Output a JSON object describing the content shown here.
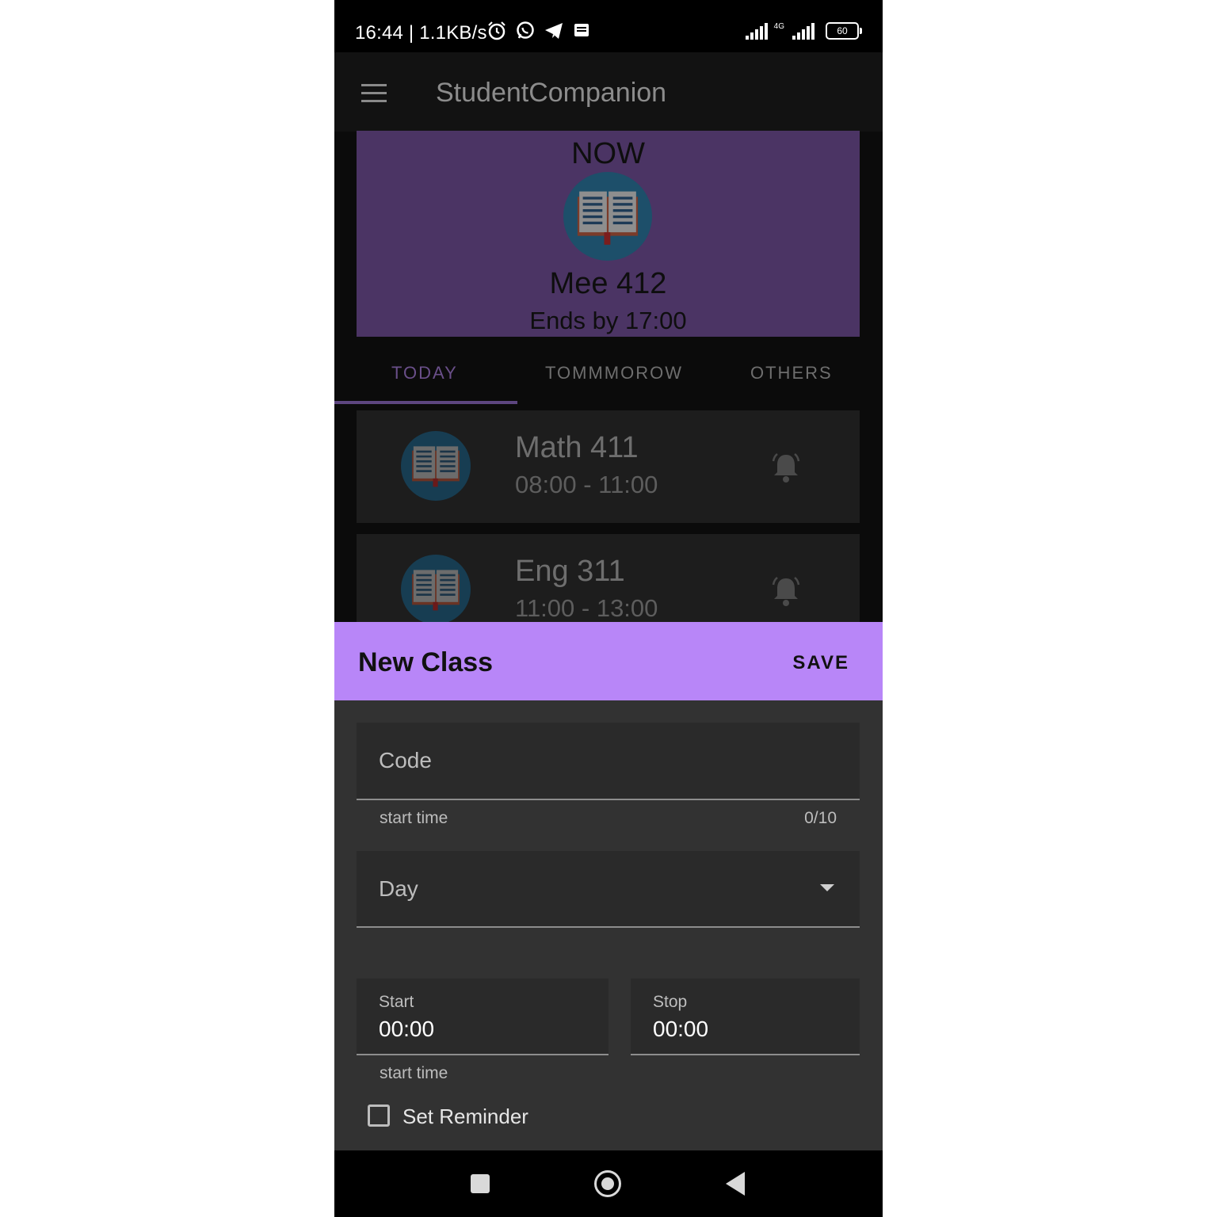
{
  "status_bar": {
    "time_text": "16:44 | 1.1KB/s",
    "icons": [
      "alarm-icon",
      "whatsapp-icon",
      "telegram-icon",
      "message-icon"
    ],
    "network": "4G",
    "battery": "60"
  },
  "app_bar": {
    "title": "StudentCompanion",
    "menu_icon": "hamburger-menu-icon"
  },
  "now_card": {
    "label": "NOW",
    "icon": "book-icon",
    "class_code": "Mee 412",
    "ends_text": "Ends by 17:00"
  },
  "tabs": [
    {
      "label": "TODAY",
      "active": true
    },
    {
      "label": "TOMMMOROW",
      "active": false
    },
    {
      "label": "OTHERS",
      "active": false
    }
  ],
  "classes": [
    {
      "title": "Math 411",
      "time": "08:00 - 11:00",
      "icon": "book-icon",
      "reminder_icon": "bell-icon"
    },
    {
      "title": "Eng 311",
      "time": "11:00 - 13:00",
      "icon": "book-icon",
      "reminder_icon": "bell-icon"
    }
  ],
  "sheet": {
    "title": "New Class",
    "save_label": "SAVE",
    "code_field": {
      "placeholder": "Code",
      "helper": "start time",
      "counter": "0/10"
    },
    "day_field": {
      "placeholder": "Day"
    },
    "start_field": {
      "label": "Start",
      "value": "00:00",
      "helper": "start time"
    },
    "stop_field": {
      "label": "Stop",
      "value": "00:00"
    },
    "reminder_label": "Set Reminder",
    "reminder_checked": false
  },
  "colors": {
    "accent": "#b886f8",
    "now_card_bg": "#4b3464",
    "sheet_bg": "#323232"
  }
}
